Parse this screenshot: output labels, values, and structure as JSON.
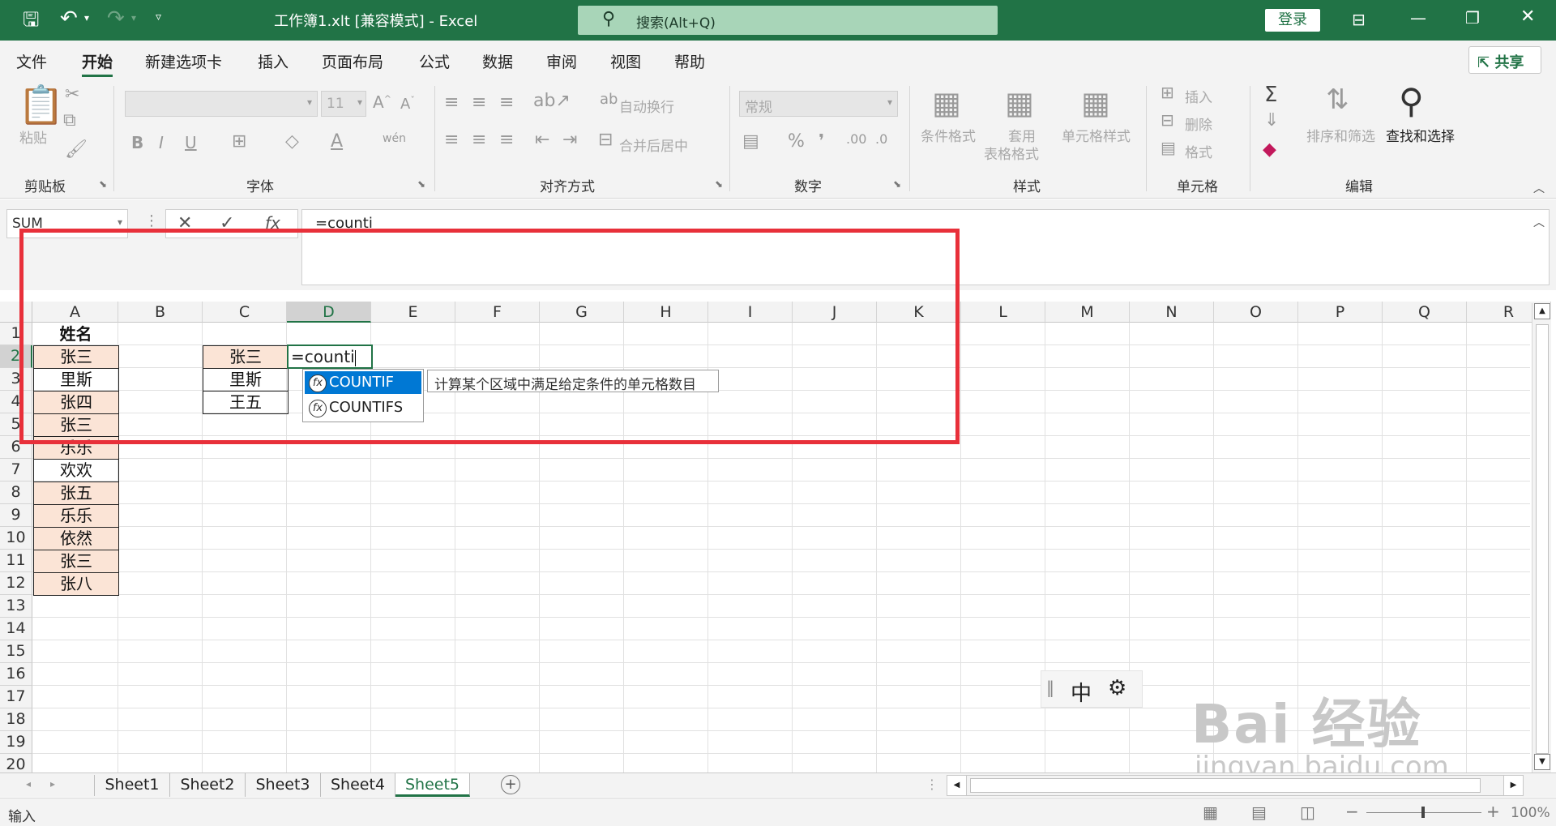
{
  "titlebar": {
    "title": "工作簿1.xlt  [兼容模式]  -  Excel",
    "search_placeholder": "搜索(Alt+Q)",
    "login": "登录"
  },
  "menu": [
    "文件",
    "开始",
    "新建选项卡",
    "插入",
    "页面布局",
    "公式",
    "数据",
    "审阅",
    "视图",
    "帮助"
  ],
  "share": "共享",
  "ribbon": {
    "clipboard": {
      "paste": "粘贴",
      "group": "剪贴板"
    },
    "font": {
      "size": "11",
      "group": "字体"
    },
    "alignment": {
      "wrap": "自动换行",
      "merge": "合并后居中",
      "group": "对齐方式"
    },
    "number": {
      "format": "常规",
      "group": "数字"
    },
    "styles": {
      "cond": "条件格式",
      "table_line1": "套用",
      "table_line2": "表格格式",
      "cell": "单元格样式",
      "group": "样式"
    },
    "cells": {
      "insert": "插入",
      "delete": "删除",
      "format": "格式",
      "group": "单元格"
    },
    "editing": {
      "sort": "排序和筛选",
      "find": "查找和选择",
      "group": "编辑"
    }
  },
  "formula_bar": {
    "name_box": "SUM",
    "formula": "=counti"
  },
  "columns": [
    "A",
    "B",
    "C",
    "D",
    "E",
    "F",
    "G",
    "H",
    "I",
    "J",
    "K",
    "L",
    "M",
    "N",
    "O",
    "P",
    "Q",
    "R"
  ],
  "rows": [
    "1",
    "2",
    "3",
    "4",
    "5",
    "6",
    "7",
    "8",
    "9",
    "10",
    "11",
    "12",
    "13",
    "14",
    "15",
    "16",
    "17",
    "18",
    "19",
    "20"
  ],
  "col_a": [
    "姓名",
    "张三",
    "里斯",
    "张四",
    "张三",
    "乐乐",
    "欢欢",
    "张五",
    "乐乐",
    "依然",
    "张三",
    "张八"
  ],
  "col_c": [
    "张三",
    "里斯",
    "王五"
  ],
  "edit_cell": "=counti",
  "autocomplete": {
    "items": [
      "COUNTIF",
      "COUNTIFS"
    ],
    "tooltip": "计算某个区域中满足给定条件的单元格数目"
  },
  "sheets": [
    "Sheet1",
    "Sheet2",
    "Sheet3",
    "Sheet4",
    "Sheet5"
  ],
  "active_sheet": "Sheet5",
  "status": {
    "mode": "输入",
    "zoom": "100%"
  },
  "ime": {
    "label": "中"
  },
  "watermark": {
    "logo": "Bai  经验",
    "url": "jingyan.baidu.com"
  },
  "colors": {
    "accent": "#217346",
    "highlight": "#e8303a",
    "pink_fill": "#fbe4d6"
  }
}
